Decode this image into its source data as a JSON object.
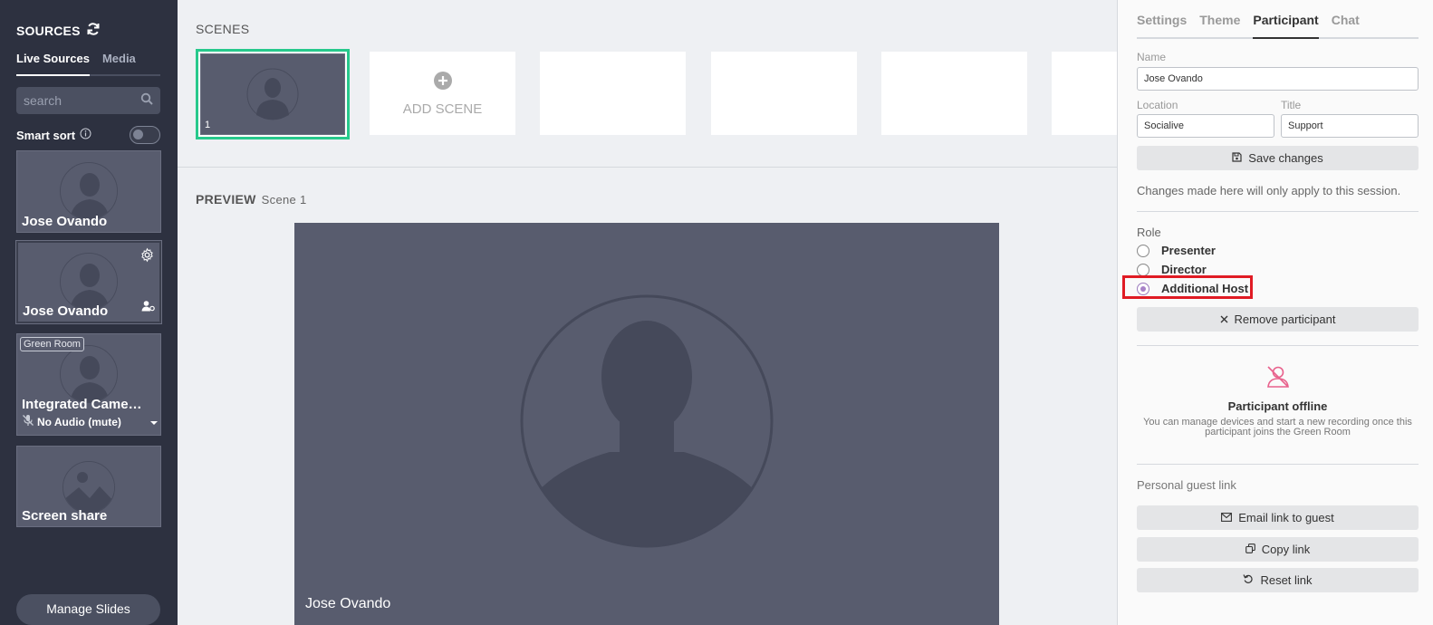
{
  "sidebar": {
    "title": "SOURCES",
    "tabs": [
      {
        "label": "Live Sources",
        "active": true
      },
      {
        "label": "Media",
        "active": false
      }
    ],
    "search_placeholder": "search",
    "smart_sort_label": "Smart sort",
    "sources": [
      {
        "name": "Jose Ovando"
      },
      {
        "name": "Jose Ovando"
      },
      {
        "name": "Integrated Came…",
        "badge": "Green Room",
        "audio": "No Audio (mute)"
      },
      {
        "name": "Screen share"
      }
    ],
    "manage_slides": "Manage Slides"
  },
  "main": {
    "scenes_label": "SCENES",
    "scene_number": "1",
    "add_scene": "ADD SCENE",
    "preview_label": "PREVIEW",
    "preview_scene": "Scene 1",
    "preview_name": "Jose Ovando"
  },
  "panel": {
    "tabs": [
      {
        "label": "Settings",
        "active": false
      },
      {
        "label": "Theme",
        "active": false
      },
      {
        "label": "Participant",
        "active": true
      },
      {
        "label": "Chat",
        "active": false
      }
    ],
    "name_label": "Name",
    "name_value": "Jose Ovando",
    "location_label": "Location",
    "location_value": "Socialive",
    "title_label": "Title",
    "title_value": "Support",
    "save_button": "Save changes",
    "note": "Changes made here will only apply to this session.",
    "role_label": "Role",
    "roles": [
      {
        "label": "Presenter",
        "checked": false
      },
      {
        "label": "Director",
        "checked": false
      },
      {
        "label": "Additional Host",
        "checked": true
      }
    ],
    "remove_button": "Remove participant",
    "offline_title": "Participant offline",
    "offline_desc": "You can manage devices and start a new recording once this participant joins the Green Room",
    "guest_link_label": "Personal guest link",
    "email_button": "Email link to guest",
    "copy_button": "Copy link",
    "reset_button": "Reset link"
  },
  "colors": {
    "sidebar_bg": "#2d3140",
    "card_bg": "#585c6e",
    "accent_green": "#27c98c",
    "highlight_red": "#e01b24",
    "radio_purple": "#a883c8",
    "offline_icon": "#e8618c"
  }
}
